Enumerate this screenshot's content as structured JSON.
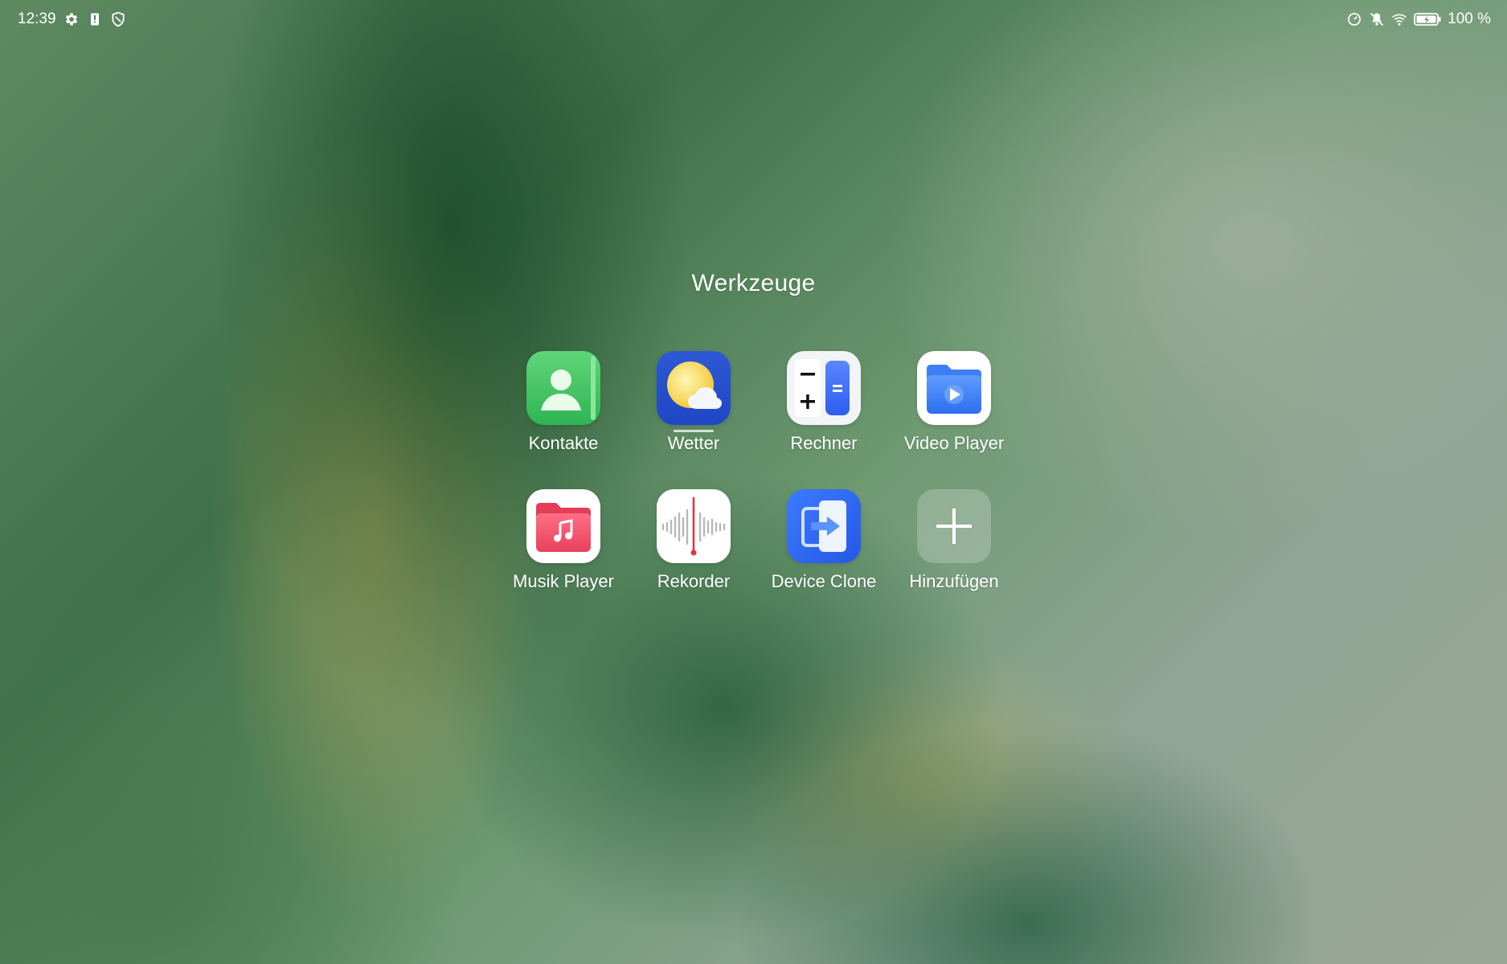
{
  "status_bar": {
    "time": "12:39",
    "left_icons": [
      "settings-icon",
      "alert-icon",
      "shield-icon"
    ],
    "right_icons": [
      "data-saver-icon",
      "mute-icon",
      "wifi-icon",
      "battery-icon"
    ],
    "battery_text": "100 %",
    "battery_level": 1.0
  },
  "folder": {
    "title": "Werkzeuge",
    "apps": [
      {
        "label": "Kontakte",
        "icon": "contacts-icon"
      },
      {
        "label": "Wetter",
        "icon": "weather-icon",
        "running": true
      },
      {
        "label": "Rechner",
        "icon": "calculator-icon"
      },
      {
        "label": "Video Player",
        "icon": "video-player-icon"
      },
      {
        "label": "Musik Player",
        "icon": "music-player-icon"
      },
      {
        "label": "Rekorder",
        "icon": "recorder-icon"
      },
      {
        "label": "Device Clone",
        "icon": "device-clone-icon"
      },
      {
        "label": "Hinzufügen",
        "icon": "add-icon"
      }
    ]
  }
}
